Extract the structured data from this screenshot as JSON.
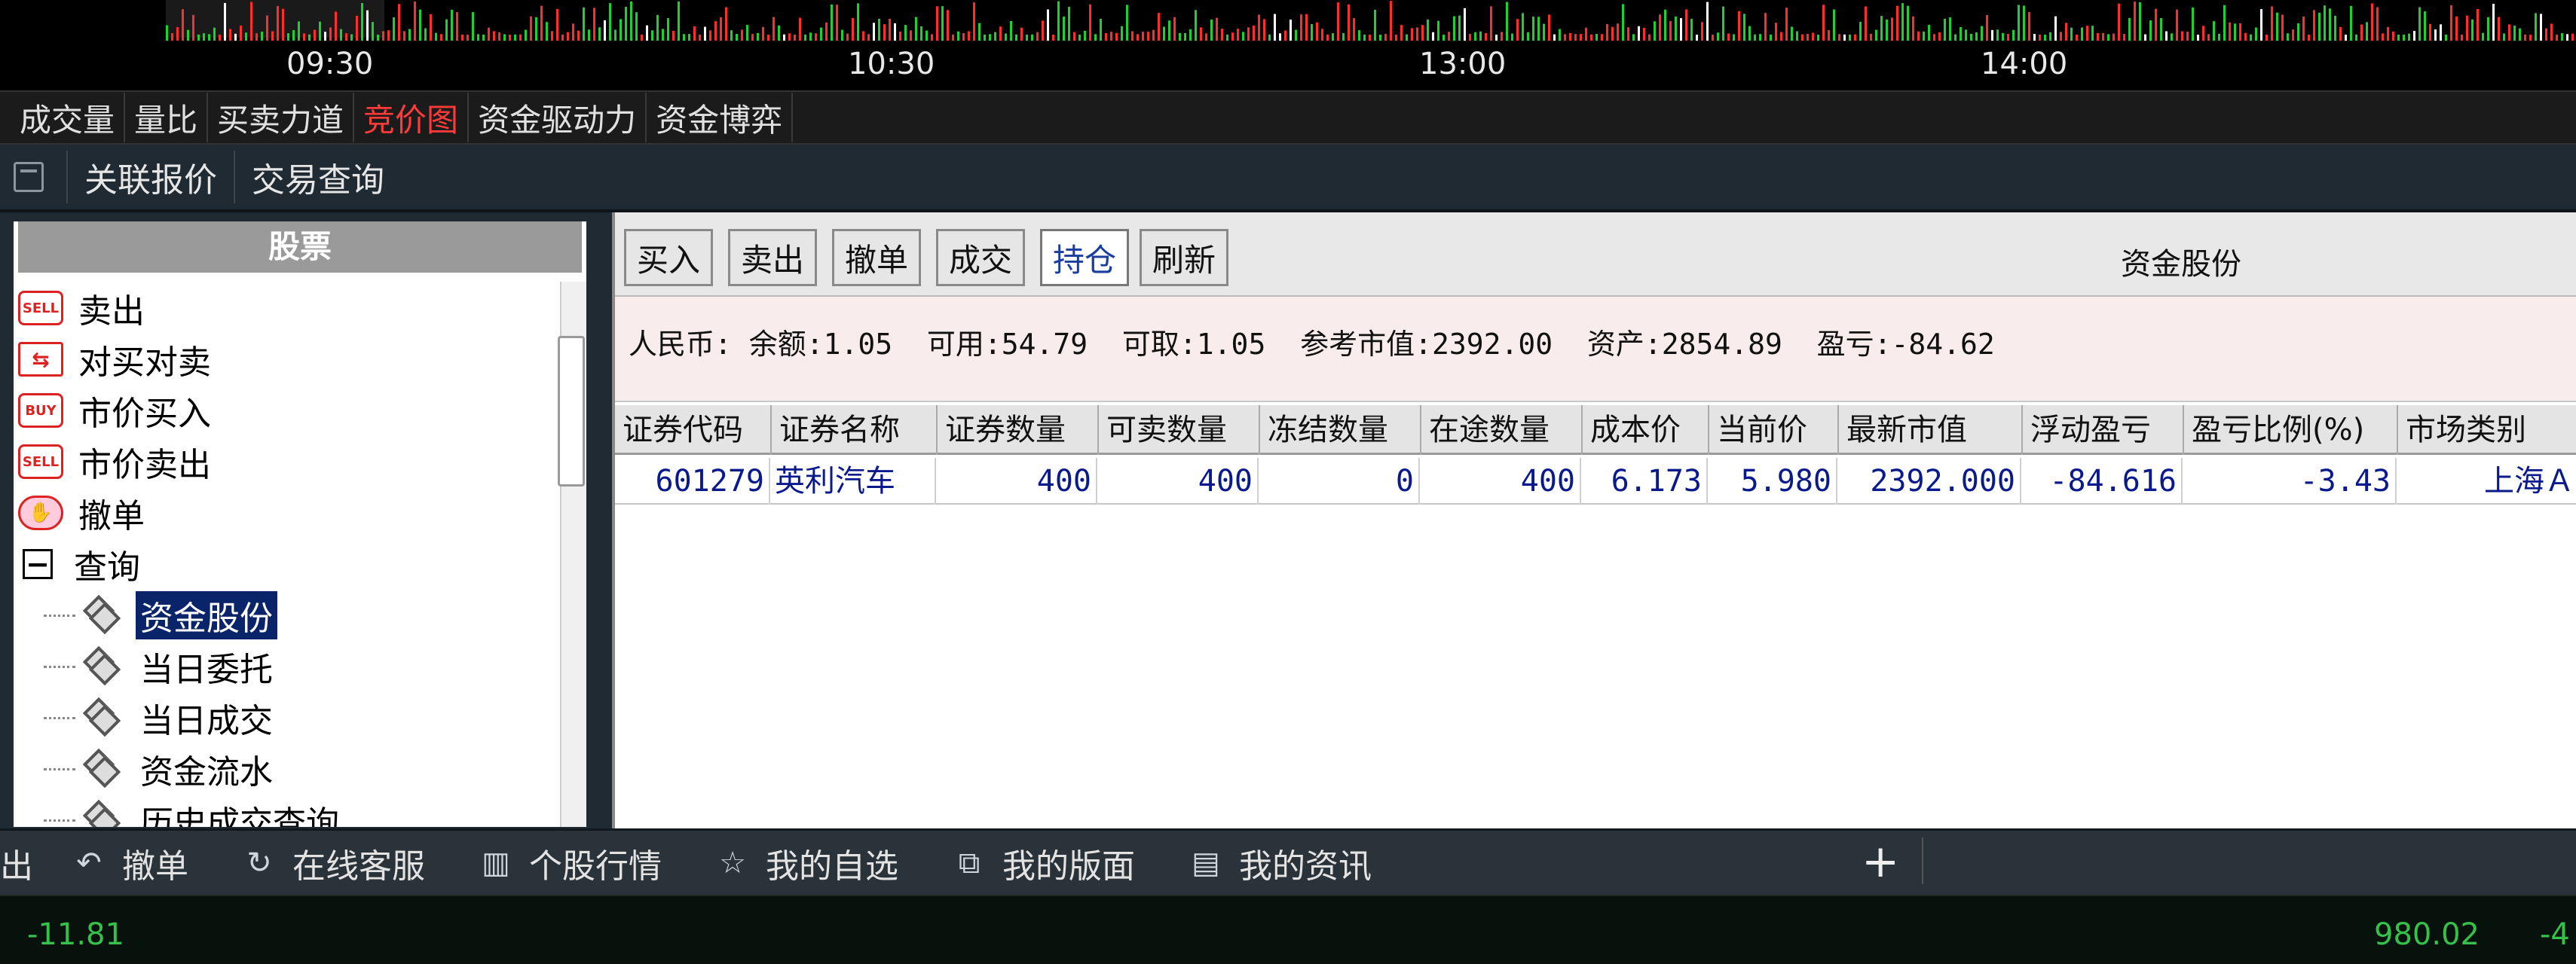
{
  "chart": {
    "time_ticks": [
      "09:30",
      "10:30",
      "13:00",
      "14:00"
    ],
    "colors": {
      "up": "#ff2d2d",
      "down": "#1bd133",
      "neutral": "#ffffff",
      "background": "#000000"
    }
  },
  "indicator_tabs": [
    {
      "label": "成交量"
    },
    {
      "label": "量比"
    },
    {
      "label": "买卖力道"
    },
    {
      "label": "竞价图",
      "active": true
    },
    {
      "label": "资金驱动力"
    },
    {
      "label": "资金博弈"
    }
  ],
  "toolbar": {
    "related_quote": "关联报价",
    "trade_query": "交易查询"
  },
  "tree": {
    "header": "股票",
    "items": [
      {
        "label": "卖出",
        "icon": "sell-icon",
        "icon_text": "SELL"
      },
      {
        "label": "对买对卖",
        "icon": "swap-icon",
        "icon_text": "⇆"
      },
      {
        "label": "市价买入",
        "icon": "buy-icon",
        "icon_text": "BUY"
      },
      {
        "label": "市价卖出",
        "icon": "sell-icon",
        "icon_text": "SELL"
      },
      {
        "label": "撤单",
        "icon": "cancel-hand-icon",
        "icon_text": "✋"
      },
      {
        "label": "查询",
        "icon": "collapse-icon",
        "icon_text": "−"
      },
      {
        "label": "资金股份",
        "icon": "pages-icon",
        "selected": true
      },
      {
        "label": "当日委托",
        "icon": "pages-icon"
      },
      {
        "label": "当日成交",
        "icon": "pages-icon"
      },
      {
        "label": "资金流水",
        "icon": "pages-icon"
      },
      {
        "label": "历史成交查询",
        "icon": "pages-icon"
      }
    ]
  },
  "actions": {
    "buy": "买入",
    "sell": "卖出",
    "cancel": "撤单",
    "deal": "成交",
    "position": "持仓",
    "refresh": "刷新",
    "title": "资金股份"
  },
  "summary": {
    "text": "人民币: 余额:1.05  可用:54.79  可取:1.05  参考市值:2392.00  资产:2854.89  盈亏:-84.62"
  },
  "grid": {
    "columns": [
      "证券代码",
      "证券名称",
      "证券数量",
      "可卖数量",
      "冻结数量",
      "在途数量",
      "成本价",
      "当前价",
      "最新市值",
      "浮动盈亏",
      "盈亏比例(%)",
      "市场类别"
    ],
    "rows": [
      [
        "601279",
        "英利汽车",
        "400",
        "400",
        "0",
        "400",
        "6.173",
        "5.980",
        "2392.000",
        "-84.616",
        "-3.43",
        "上海Ａ"
      ]
    ]
  },
  "bottom_bar": {
    "partial": "出",
    "items": [
      {
        "label": "撤单",
        "icon": "undo-icon"
      },
      {
        "label": "在线客服",
        "icon": "headset-icon"
      },
      {
        "label": "个股行情",
        "icon": "quote-icon"
      },
      {
        "label": "我的自选",
        "icon": "star-icon"
      },
      {
        "label": "我的版面",
        "icon": "layout-icon"
      },
      {
        "label": "我的资讯",
        "icon": "news-icon"
      }
    ],
    "plus": "+"
  },
  "status": {
    "left": "-11.81",
    "right1": "980.02",
    "right2": "-4"
  }
}
